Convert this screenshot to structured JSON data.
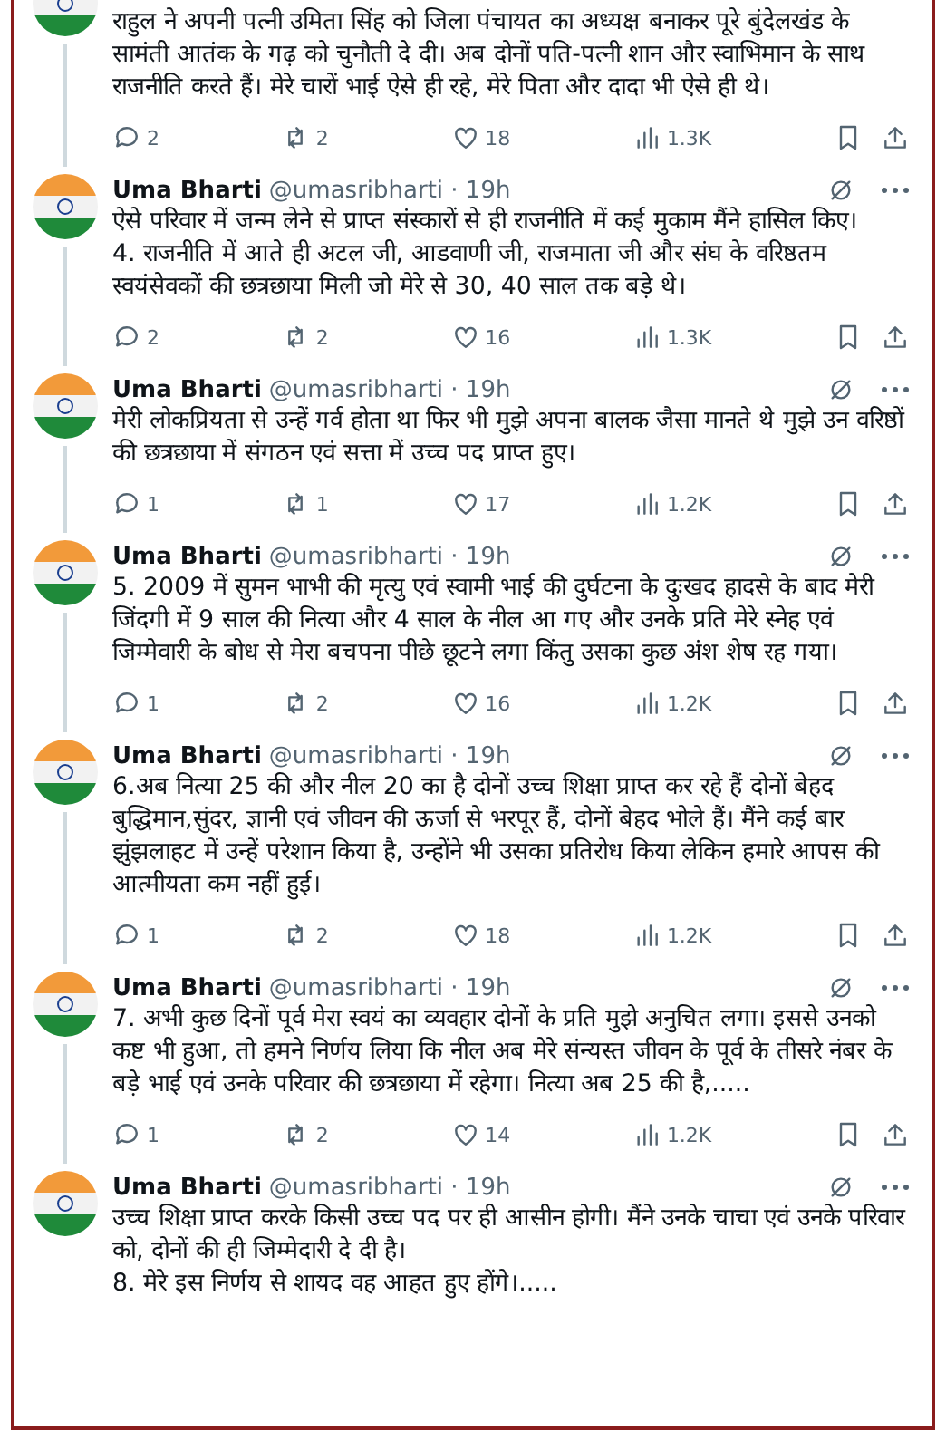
{
  "tweets": [
    {
      "text": "राहुल ने अपनी पत्नी उमिता सिंह को जिला पंचायत का अध्यक्ष बनाकर पूरे बुंदेलखंड के सामंती आतंक के गढ़ को चुनौती दे दी।  अब दोनों पति-पत्नी शान और स्वाभिमान के साथ राजनीति करते हैं।  मेरे चारों भाई ऐसे ही रहे, मेरे पिता और दादा भी ऐसे ही थे।",
      "replies": "2",
      "reposts": "2",
      "likes": "18",
      "views": "1.3K"
    },
    {
      "name": "Uma Bharti",
      "meta": "@umasribharti · 19h",
      "text": "ऐसे परिवार में जन्म लेने से प्राप्त संस्कारों से ही राजनीति में कई मुकाम मैंने हासिल किए।\n4. राजनीति में आते ही अटल जी, आडवाणी जी,  राजमाता जी और संघ के वरिष्ठतम स्वयंसेवकों की छत्रछाया मिली जो मेरे से 30, 40 साल तक बड़े थे।",
      "replies": "2",
      "reposts": "2",
      "likes": "16",
      "views": "1.3K"
    },
    {
      "name": "Uma Bharti",
      "meta": "@umasribharti · 19h",
      "text": "मेरी लोकप्रियता से उन्हें गर्व होता था फिर भी मुझे अपना बालक जैसा मानते थे मुझे उन वरिष्ठों की छत्रछाया में संगठन एवं सत्ता में उच्च पद प्राप्त हुए।",
      "replies": "1",
      "reposts": "1",
      "likes": "17",
      "views": "1.2K"
    },
    {
      "name": "Uma Bharti",
      "meta": "@umasribharti · 19h",
      "text": "5. 2009 में सुमन भाभी की मृत्यु एवं स्वामी भाई की दुर्घटना के दुःखद हादसे के बाद मेरी जिंदगी में 9 साल की नित्या और 4 साल के नील आ गए और उनके प्रति मेरे स्नेह एवं जिम्मेवारी के बोध से मेरा बचपना पीछे छूटने लगा किंतु उसका कुछ अंश शेष रह गया।",
      "replies": "1",
      "reposts": "2",
      "likes": "16",
      "views": "1.2K"
    },
    {
      "name": "Uma Bharti",
      "meta": "@umasribharti · 19h",
      "text": "6.अब नित्या 25 की और नील 20 का है दोनों उच्च शिक्षा प्राप्त कर रहे हैं दोनों बेहद बुद्धिमान,सुंदर, ज्ञानी एवं जीवन की ऊर्जा से भरपूर हैं, दोनों बेहद भोले हैं। मैंने कई बार झुंझलाहट में उन्हें परेशान किया है, उन्होंने भी उसका प्रतिरोध किया लेकिन हमारे आपस की आत्मीयता कम नहीं हुई।",
      "replies": "1",
      "reposts": "2",
      "likes": "18",
      "views": "1.2K"
    },
    {
      "name": "Uma Bharti",
      "meta": "@umasribharti · 19h",
      "text": "7. अभी कुछ दिनों पूर्व मेरा स्वयं का व्यवहार दोनों के प्रति मुझे अनुचित लगा।  इससे उनको कष्ट भी हुआ, तो हमने निर्णय लिया कि नील अब मेरे संन्यस्त जीवन के पूर्व के तीसरे नंबर के बड़े भाई एवं उनके परिवार की छत्रछाया में रहेगा।  नित्या अब 25 की है,.....",
      "replies": "1",
      "reposts": "2",
      "likes": "14",
      "views": "1.2K"
    },
    {
      "name": "Uma Bharti",
      "meta": "@umasribharti · 19h",
      "text": "उच्च शिक्षा प्राप्त करके किसी उच्च पद पर ही आसीन होगी।  मैंने उनके चाचा एवं उनके परिवार को,  दोनों की ही जिम्मेदारी दे दी है।\n8. मेरे इस निर्णय से शायद वह आहत हुए होंगे।....."
    }
  ]
}
